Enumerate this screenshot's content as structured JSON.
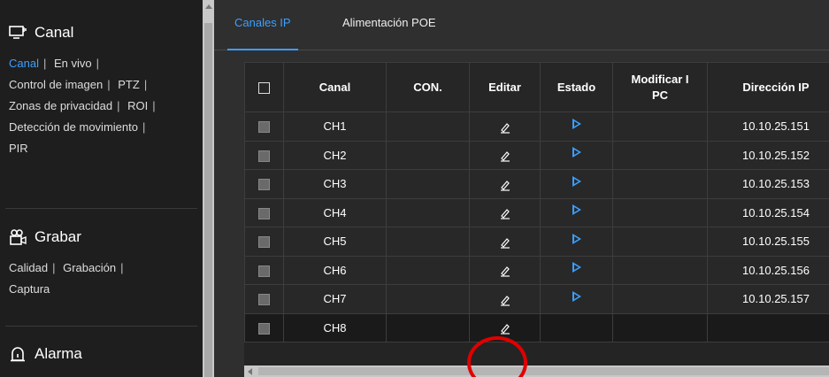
{
  "sidebar": {
    "canal": {
      "title": "Canal",
      "links": [
        "Canal",
        "En vivo",
        "Control de imagen",
        "PTZ",
        "Zonas de privacidad",
        "ROI",
        "Detección de movimiento",
        "PIR"
      ]
    },
    "grabar": {
      "title": "Grabar",
      "links": [
        "Calidad",
        "Grabación",
        "Captura"
      ]
    },
    "alarma": {
      "title": "Alarma"
    }
  },
  "tabs": [
    "Canales IP",
    "Alimentación POE"
  ],
  "table": {
    "headers": {
      "canal": "Canal",
      "con": "CON.",
      "editar": "Editar",
      "estado": "Estado",
      "modificar_l": "Modificar I",
      "modificar_2": "PC",
      "ip": "Dirección IP"
    },
    "rows": [
      {
        "canal": "CH1",
        "ip": "10.10.25.151"
      },
      {
        "canal": "CH2",
        "ip": "10.10.25.152"
      },
      {
        "canal": "CH3",
        "ip": "10.10.25.153"
      },
      {
        "canal": "CH4",
        "ip": "10.10.25.154"
      },
      {
        "canal": "CH5",
        "ip": "10.10.25.155"
      },
      {
        "canal": "CH6",
        "ip": "10.10.25.156"
      },
      {
        "canal": "CH7",
        "ip": "10.10.25.157"
      },
      {
        "canal": "CH8",
        "ip": ""
      }
    ]
  },
  "colors": {
    "accent": "#3ba0ff",
    "highlight": "#e00000"
  }
}
